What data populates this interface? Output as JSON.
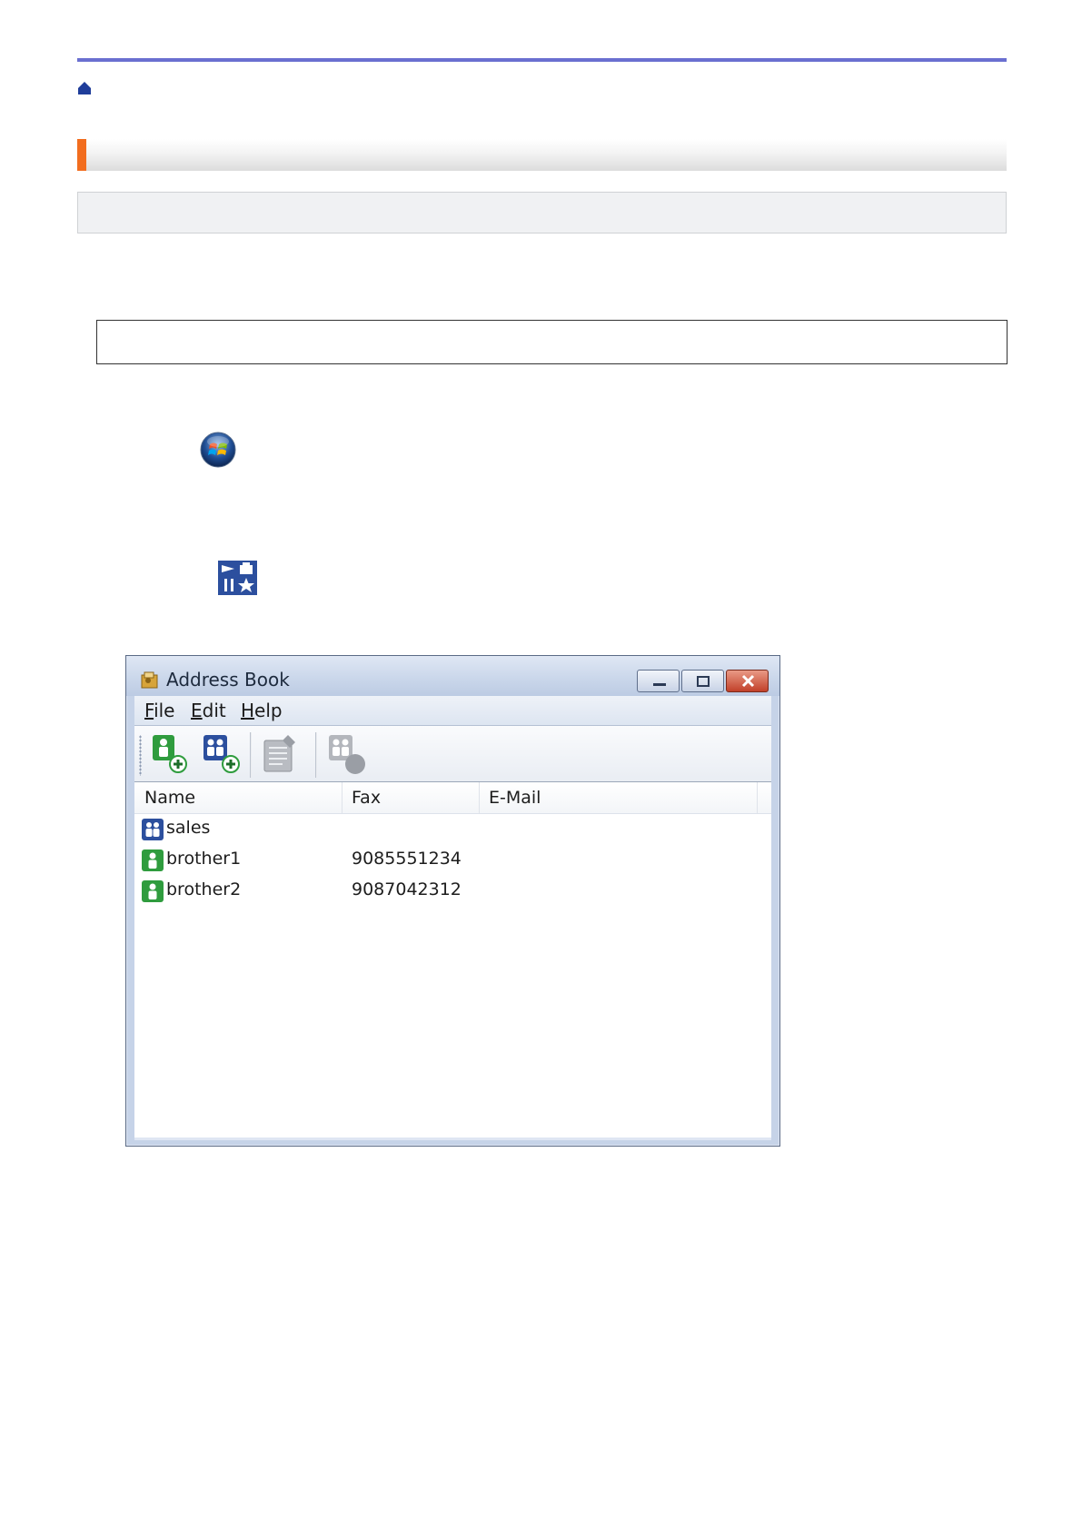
{
  "window": {
    "title": "Address Book",
    "menu": [
      "File",
      "Edit",
      "Help"
    ],
    "toolbar_icons": [
      "add-contact-icon",
      "add-group-icon",
      "edit-icon",
      "delete-icon"
    ]
  },
  "list": {
    "columns": [
      "Name",
      "Fax",
      "E-Mail"
    ],
    "rows": [
      {
        "name": "sales",
        "fax": "",
        "email": "",
        "icon": "group-icon"
      },
      {
        "name": "brother1",
        "fax": "9085551234",
        "email": "",
        "icon": "contact-icon"
      },
      {
        "name": "brother2",
        "fax": "9087042312",
        "email": "",
        "icon": "contact-icon"
      }
    ]
  },
  "colors": {
    "rule": "#6a6fd0",
    "accent": "#f26d1e",
    "contact_icon": "#2f9c3e",
    "group_icon": "#2c4f9e"
  }
}
